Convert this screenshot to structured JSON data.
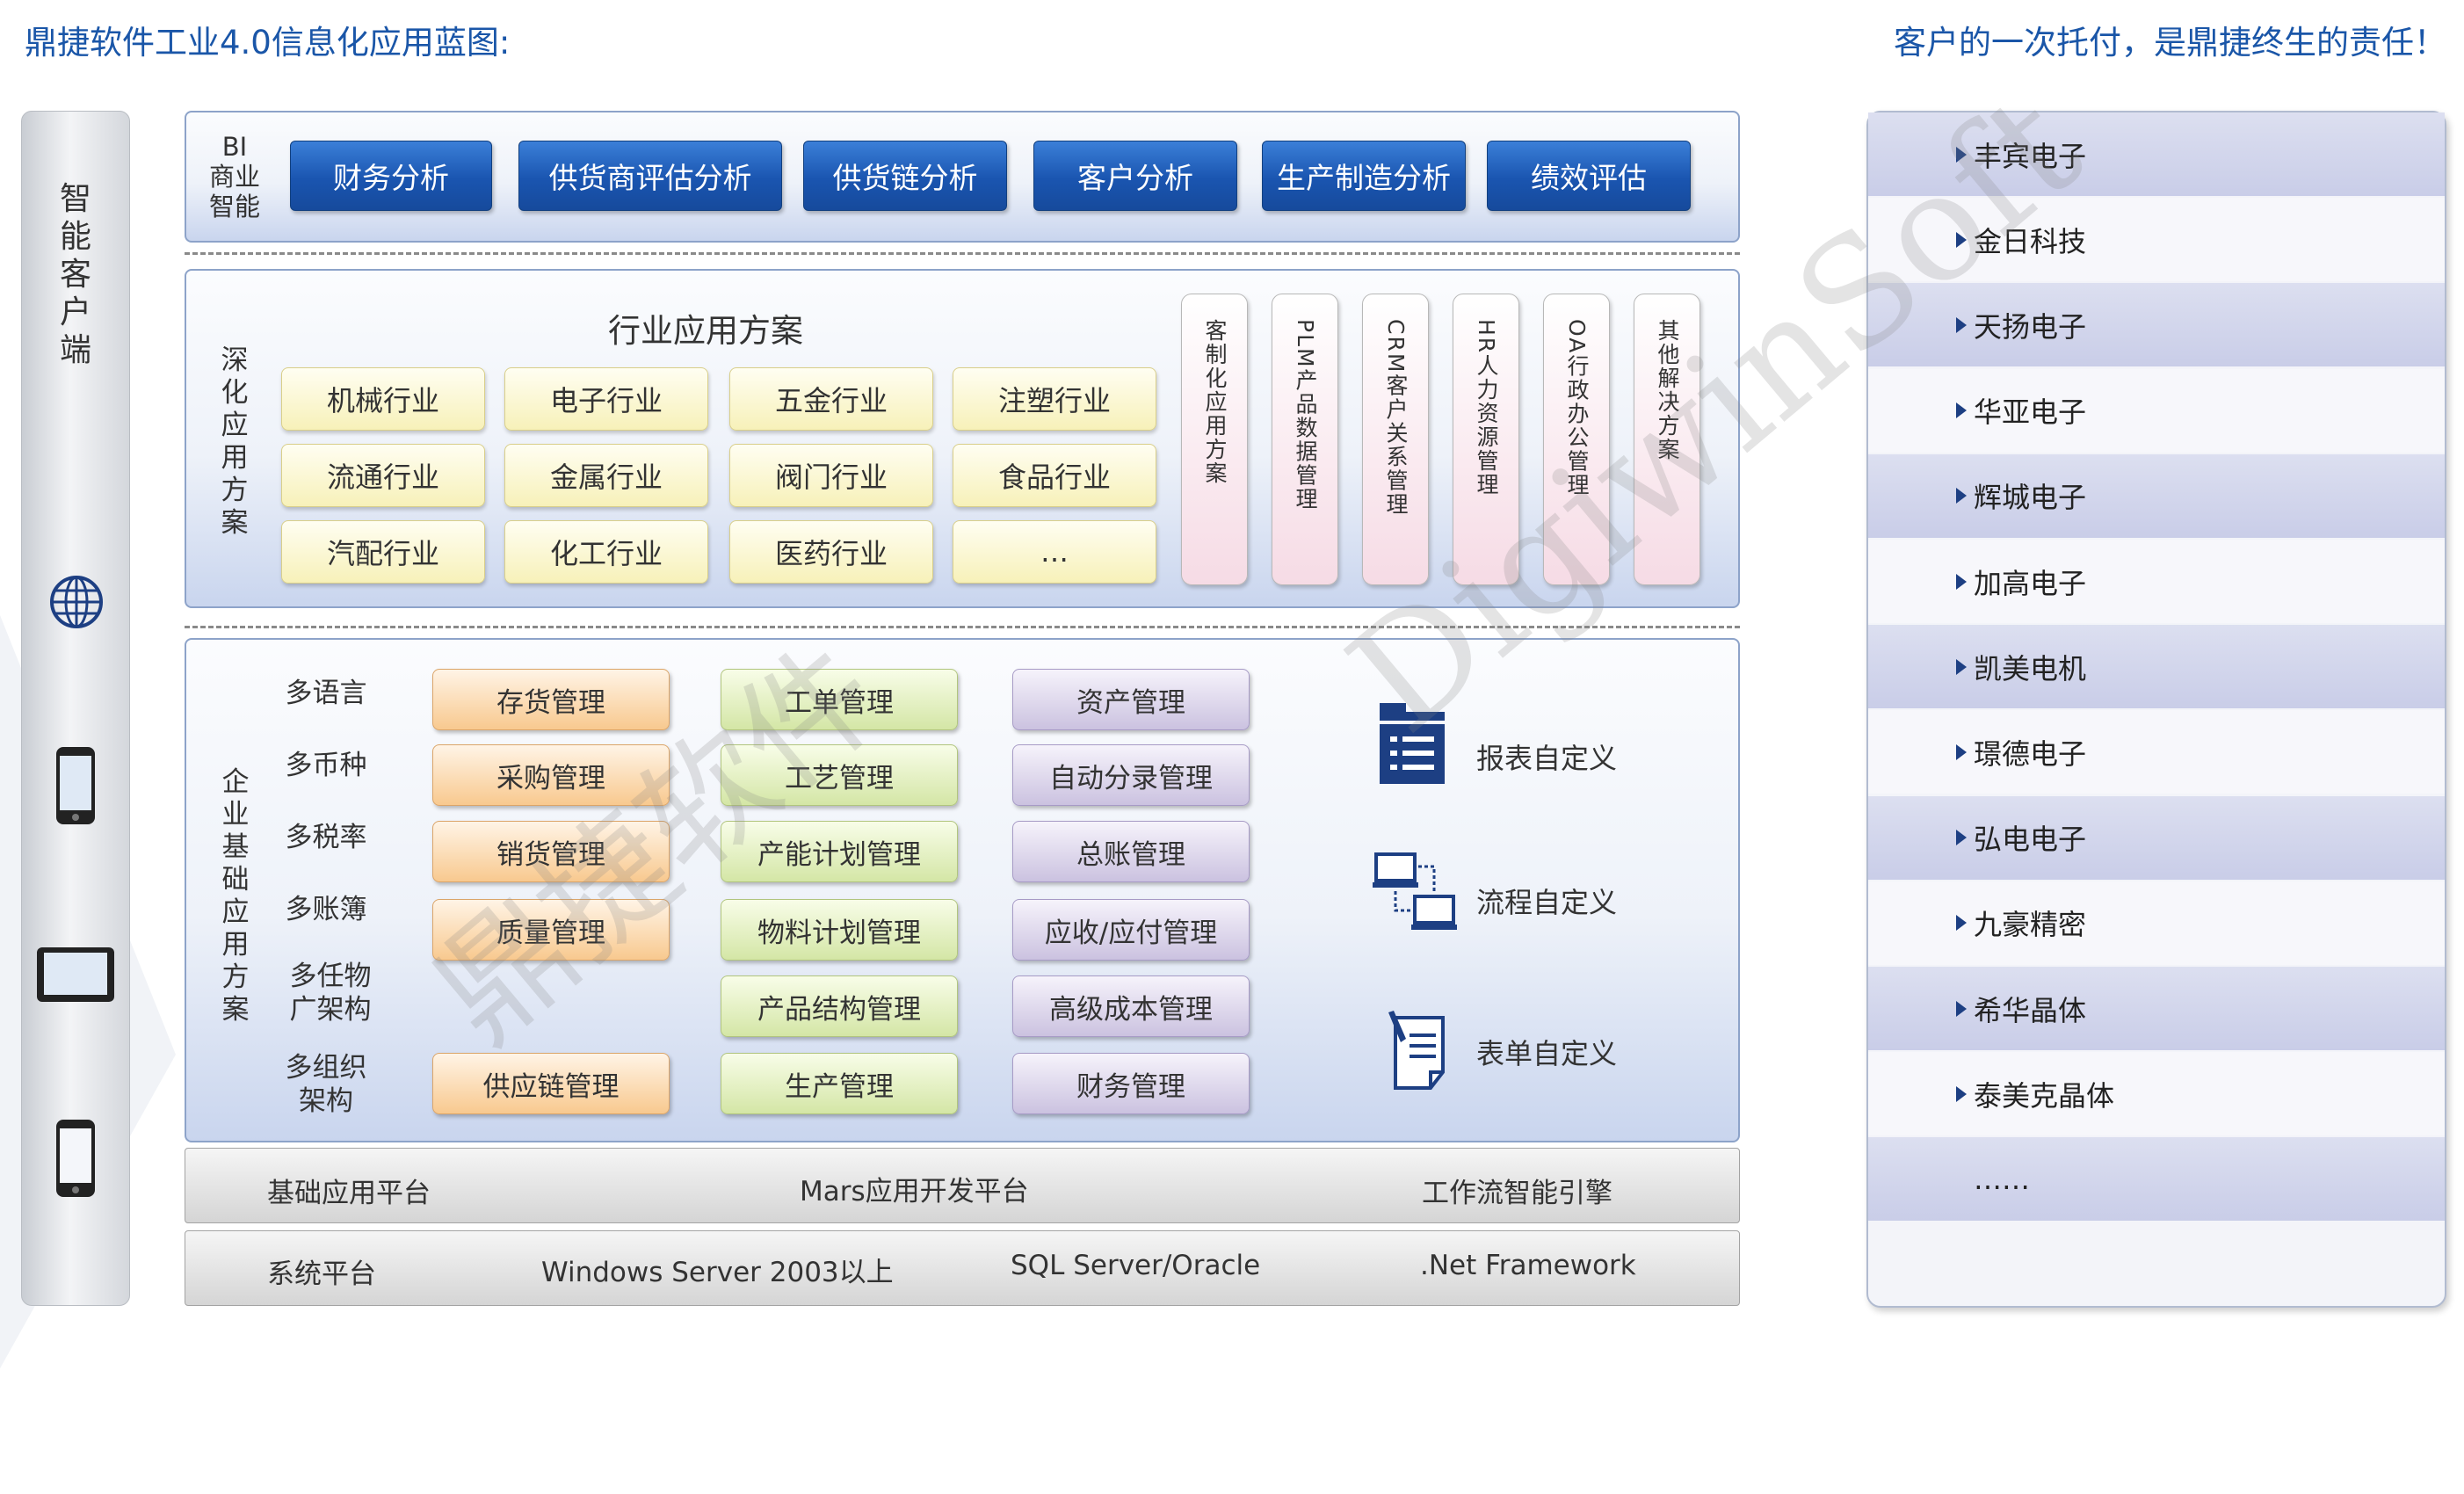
{
  "header": {
    "left_title": "鼎捷软件工业4.0信息化应用蓝图:",
    "right_title": "客户的一次托付，是鼎捷终生的责任！"
  },
  "client": {
    "label": "智能客户端"
  },
  "bi": {
    "label_line1": "BI",
    "label_line2": "商业",
    "label_line3": "智能",
    "buttons": [
      "财务分析",
      "供货商评估分析",
      "供货链分析",
      "客户分析",
      "生产制造分析",
      "绩效评估"
    ]
  },
  "industry": {
    "side_label": "深化应用方案",
    "title": "行业应用方案",
    "items": [
      "机械行业",
      "电子行业",
      "五金行业",
      "注塑行业",
      "流通行业",
      "金属行业",
      "阀门行业",
      "食品行业",
      "汽配行业",
      "化工行业",
      "医药行业",
      "…"
    ],
    "solutions": [
      "客制化应用方案",
      "PLM产品数据管理",
      "CRM客户关系管理",
      "HR人力资源管理",
      "OA行政办公管理",
      "其他解决方案"
    ]
  },
  "enterprise": {
    "side_label": "企业基础应用方案",
    "multi": [
      "多语言",
      "多币种",
      "多税率",
      "多账簿",
      "多任物广架构",
      "多组织架构"
    ],
    "col1": [
      "存货管理",
      "采购管理",
      "销货管理",
      "质量管理",
      "供应链管理"
    ],
    "col2": [
      "工单管理",
      "工艺管理",
      "产能计划管理",
      "物料计划管理",
      "产品结构管理",
      "生产管理"
    ],
    "col3": [
      "资产管理",
      "自动分录管理",
      "总账管理",
      "应收/应付管理",
      "高级成本管理",
      "财务管理"
    ],
    "custom": [
      "报表自定义",
      "流程自定义",
      "表单自定义"
    ]
  },
  "platform": {
    "base_label": "基础应用平台",
    "mars": "Mars应用开发平台",
    "workflow": "工作流智能引擎",
    "sys_label": "系统平台",
    "os": "Windows Server 2003以上",
    "db": "SQL Server/Oracle",
    "net": ".Net Framework"
  },
  "customers": [
    "丰宾电子",
    "金日科技",
    "天扬电子",
    "华亚电子",
    "辉城电子",
    "加高电子",
    "凯美电机",
    "璟德电子",
    "弘电电子",
    "九豪精密",
    "希华晶体",
    "泰美克晶体"
  ],
  "customers_more": "……",
  "watermark": {
    "cn": "鼎捷软件",
    "en": "DigiwinSoft"
  },
  "colors": {
    "title_blue": "#1a56a8",
    "bi_blue": "#1a55b0",
    "panel_border": "#8da3c9"
  }
}
